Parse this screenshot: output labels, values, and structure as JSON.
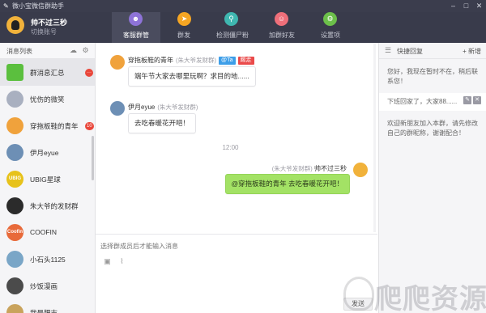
{
  "window": {
    "title": "微小宝微信群助手",
    "controls": [
      "minimize-icon",
      "maximize-icon",
      "close-icon"
    ]
  },
  "profile": {
    "name": "帅不过三秒",
    "switch_label": "切换账号"
  },
  "nav": {
    "tabs": [
      {
        "label": "客服群管",
        "icon": "group-icon",
        "color": "#8e73d8",
        "active": true
      },
      {
        "label": "群发",
        "icon": "send-icon",
        "color": "#f6a623",
        "active": false
      },
      {
        "label": "检测僵尸粉",
        "icon": "detect-icon",
        "color": "#3fb7b0",
        "active": false
      },
      {
        "label": "加群好友",
        "icon": "add-friend-icon",
        "color": "#ef6f7a",
        "active": false
      },
      {
        "label": "设置项",
        "icon": "gear-icon",
        "color": "#6cc04a",
        "active": false
      }
    ]
  },
  "sessions": {
    "header": "消息列表",
    "items": [
      {
        "name": "群消息汇总",
        "badge": "···",
        "avatar_color": "#5bbf3e",
        "avatar_text": "",
        "active": true
      },
      {
        "name": "忧伤的微笑",
        "badge": "",
        "avatar_color": "#a9b0c0",
        "avatar_text": ""
      },
      {
        "name": "穿拖板鞋的青年",
        "badge": "10",
        "avatar_color": "#f0a23c",
        "avatar_text": ""
      },
      {
        "name": "伊月eyue",
        "badge": "",
        "avatar_color": "#6d8fb5",
        "avatar_text": ""
      },
      {
        "name": "UBIG星球",
        "badge": "",
        "avatar_color": "#e7c21b",
        "avatar_text": "UBIG"
      },
      {
        "name": "朱大爷的发财群",
        "badge": "",
        "avatar_color": "#2b2b2b",
        "avatar_text": ""
      },
      {
        "name": "COOFIN",
        "badge": "",
        "avatar_color": "#e86a3a",
        "avatar_text": "Coofin"
      },
      {
        "name": "小石头1125",
        "badge": "",
        "avatar_color": "#7aa6c7",
        "avatar_text": ""
      },
      {
        "name": "炒饭漫画",
        "badge": "",
        "avatar_color": "#4b4b4b",
        "avatar_text": ""
      },
      {
        "name": "我是肥志",
        "badge": "",
        "avatar_color": "#c9a35c",
        "avatar_text": ""
      }
    ]
  },
  "chat": {
    "messages": [
      {
        "sender": "穿拖板鞋的青年",
        "group": "(朱大爷发财群)",
        "tags": [
          {
            "text": "@Ta",
            "color": "#3d9ee8"
          },
          {
            "text": "踢走",
            "color": "#ea4a4a"
          }
        ],
        "text": "端午节大家去哪里玩啊？求目的地......",
        "avatar_color": "#f0a23c"
      },
      {
        "sender": "伊月eyue",
        "group": "(朱大爷发财群)",
        "tags": [],
        "text": "去吃春暖花开吧！",
        "avatar_color": "#6d8fb5"
      }
    ],
    "timestamp": "12:00",
    "outgoing": {
      "group": "(朱大爷发财群)",
      "sender": "帅不过三秒",
      "text": "@穿拖板鞋的青年 去吃春暖花开吧！"
    },
    "input_placeholder": "选择群成员后才能输入消息",
    "send_label": "发送"
  },
  "quick_reply": {
    "title": "快捷回复",
    "add_label": "新增",
    "items": [
      {
        "text": "您好，我现在暂时不在，稍后联系您！",
        "lines": [
          "您好，我现在暂时不在，稍后联",
          "系您！"
        ]
      },
      {
        "text": "下班回家了，大家88......",
        "lines": [
          "下班回家了，大家88......"
        ],
        "selected": true
      },
      {
        "text": "欢迎新朋友加入本群，请先修改自己的群昵称，谢谢配合！",
        "lines": [
          "欢迎新朋友加入本群，请先修改",
          "自己的群昵称，谢谢配合！"
        ]
      }
    ]
  },
  "watermark": {
    "text": "爬爬资源"
  }
}
